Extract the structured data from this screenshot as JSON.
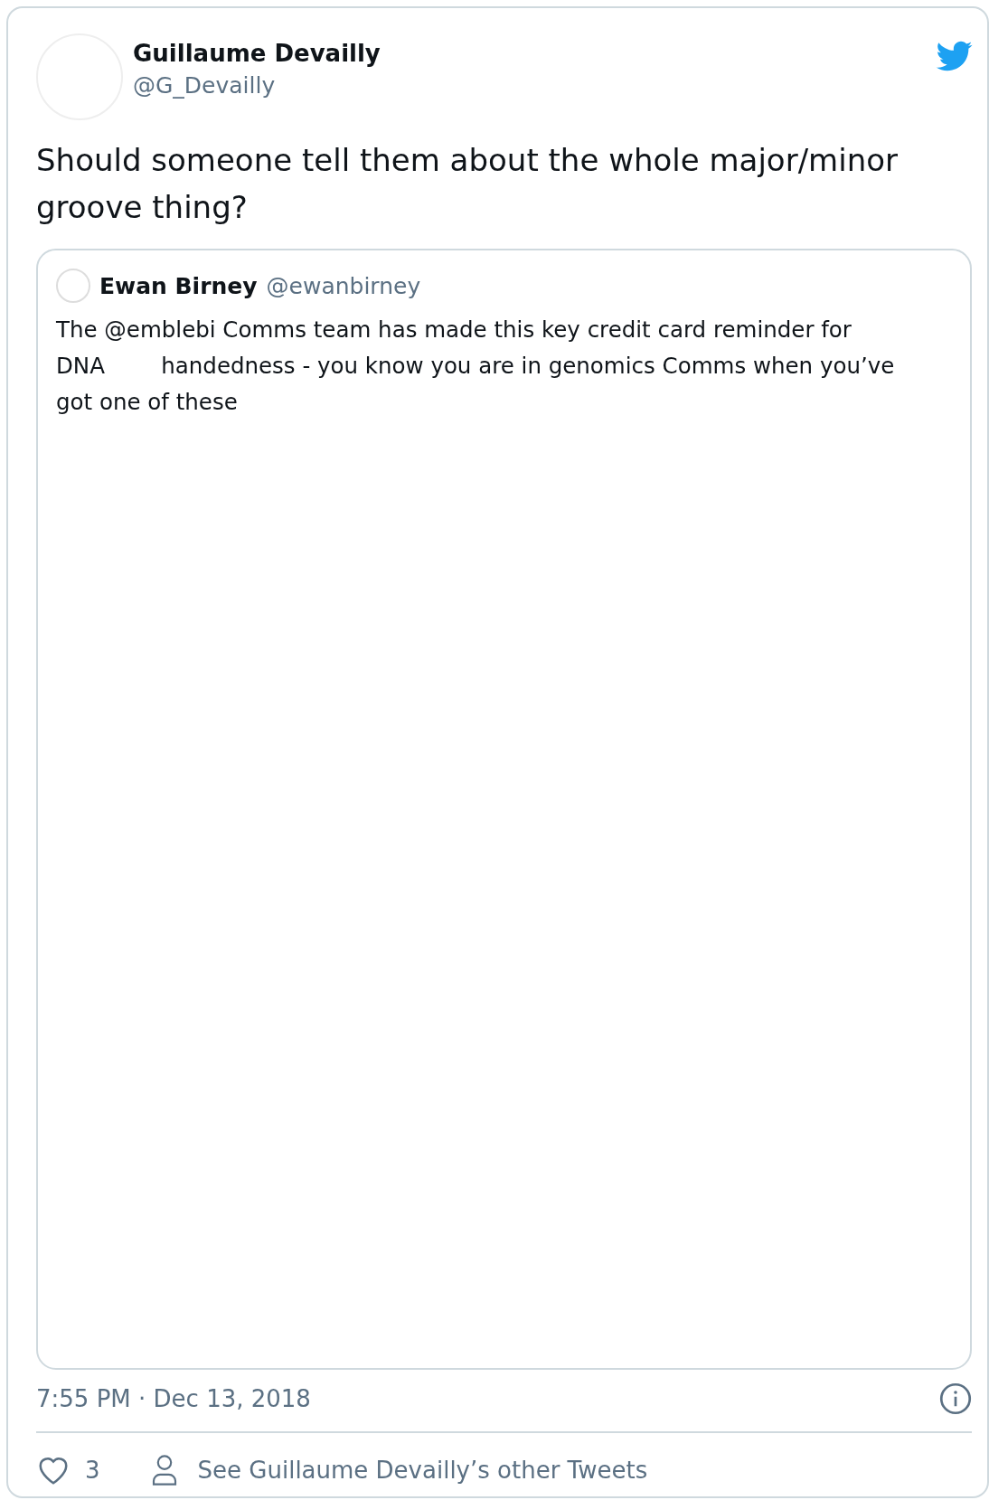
{
  "author": {
    "name": "Guillaume Devailly",
    "handle": "@G_Devailly"
  },
  "text": "Should someone tell them about the whole major/minor groove thing?",
  "quoted": {
    "name": "Ewan Birney",
    "handle": "@ewanbirney",
    "text": "The @emblebi Comms team has made this key credit card reminder for DNA        handedness - you know you are in genomics Comms when you’ve got one of these"
  },
  "timestamp": "7:55 PM · Dec 13, 2018",
  "likes": "3",
  "profile_link": "See Guillaume Devailly’s other Tweets"
}
